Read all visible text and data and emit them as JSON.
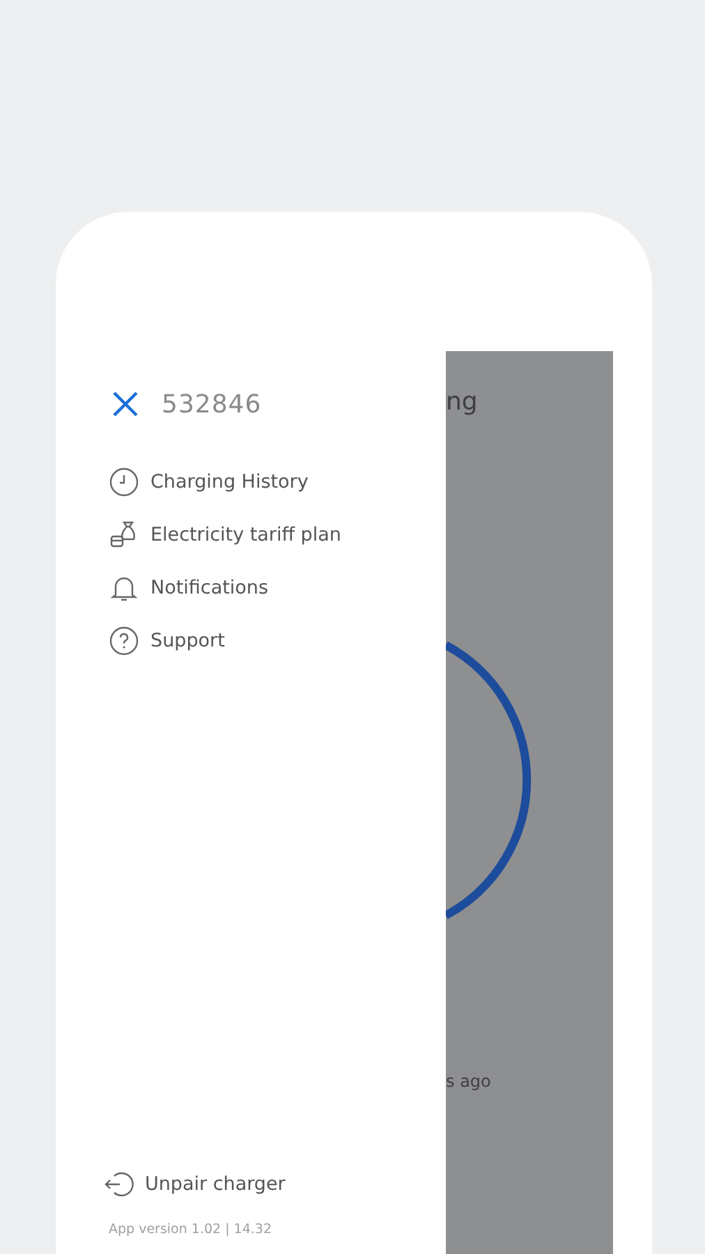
{
  "drawer": {
    "charger_id": "532846",
    "menu": [
      {
        "label": "Charging History",
        "kind": "clock"
      },
      {
        "label": "Electricity tariff plan",
        "kind": "tariff"
      },
      {
        "label": "Notifications",
        "kind": "bell"
      },
      {
        "label": "Support",
        "kind": "help"
      }
    ],
    "unpair": "Unpair charger",
    "app_version": "App version 1.02 | 14.32"
  },
  "background_screen": {
    "title": "ng",
    "status": "s ago"
  }
}
